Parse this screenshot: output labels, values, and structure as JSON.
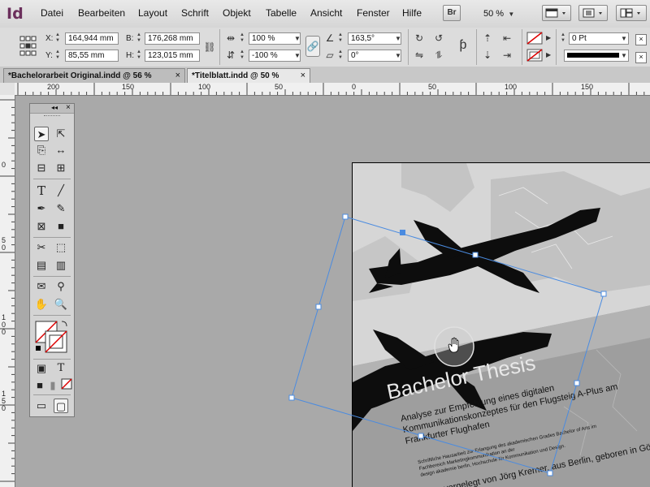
{
  "app": {
    "logo": "Id"
  },
  "menu": [
    "Datei",
    "Bearbeiten",
    "Layout",
    "Schrift",
    "Objekt",
    "Tabelle",
    "Ansicht",
    "Fenster",
    "Hilfe"
  ],
  "menubar": {
    "br_label": "Br",
    "zoom": "50 %"
  },
  "control": {
    "x_label": "X:",
    "x_value": "164,944 mm",
    "y_label": "Y:",
    "y_value": "85,55 mm",
    "b_label": "B:",
    "b_value": "176,268 mm",
    "h_label": "H:",
    "h_value": "123,015 mm",
    "scale_x": "100 %",
    "scale_y": "-100 %",
    "rotation": "163,5°",
    "shear": "0°",
    "stroke_weight": "0 Pt"
  },
  "tabs": [
    {
      "label": "*Bachelorarbeit Original.indd @ 56 %",
      "close": "×"
    },
    {
      "label": "*Titelblatt.indd @ 50 %",
      "close": "×"
    }
  ],
  "ruler": {
    "h_labels": [
      "200",
      "150",
      "100",
      "50",
      "0",
      "50",
      "100",
      "150"
    ],
    "v_labels": [
      "0",
      "50",
      "100",
      "150"
    ]
  },
  "tools_panel": {
    "collapse": "◂◂",
    "close": "×"
  },
  "page_text": {
    "title": "Bachelor Thesis",
    "subtitle_line1": "Analyse zur Empfehlung eines digitalen",
    "subtitle_line2": "Kommunikationskonzeptes für den Flugsteig A-Plus am",
    "subtitle_line3": "Frankfurter Flughafen",
    "small_line1": "Schriftliche Hausarbeit zur Erlangung des akademischen Grades Bachelor of Arts im",
    "small_line2": "Fachbereich Marketingkommunikation an der",
    "small_line3": "design akademie berlin, Hochschule für Kommunikation und Design.",
    "author_line": "vorgelegt von Jörg Kremer, aus Berlin, geboren in Göttingen"
  },
  "colors": {
    "accent_logo": "#6b2f5c",
    "selection": "#4a8be0",
    "pasteboard": "#a9a9a9"
  }
}
